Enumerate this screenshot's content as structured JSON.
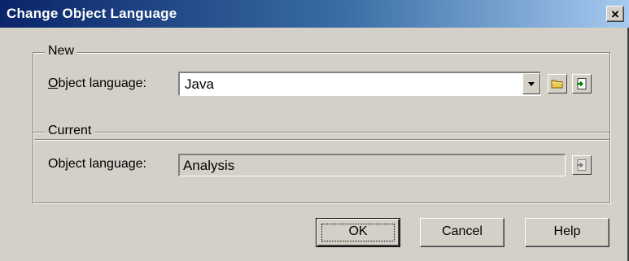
{
  "window": {
    "title": "Change Object Language",
    "close_label": "×"
  },
  "new_group": {
    "legend": "New",
    "label_first": "O",
    "label_rest": "bject language:",
    "combo_value": "Java"
  },
  "current_group": {
    "legend": "Current",
    "label": "Object language:",
    "value": "Analysis"
  },
  "buttons": {
    "ok": "OK",
    "cancel": "Cancel",
    "help": "Help"
  },
  "icons": {
    "dropdown": "chevron-down-icon",
    "browse": "folder-icon",
    "properties": "properties-icon"
  }
}
